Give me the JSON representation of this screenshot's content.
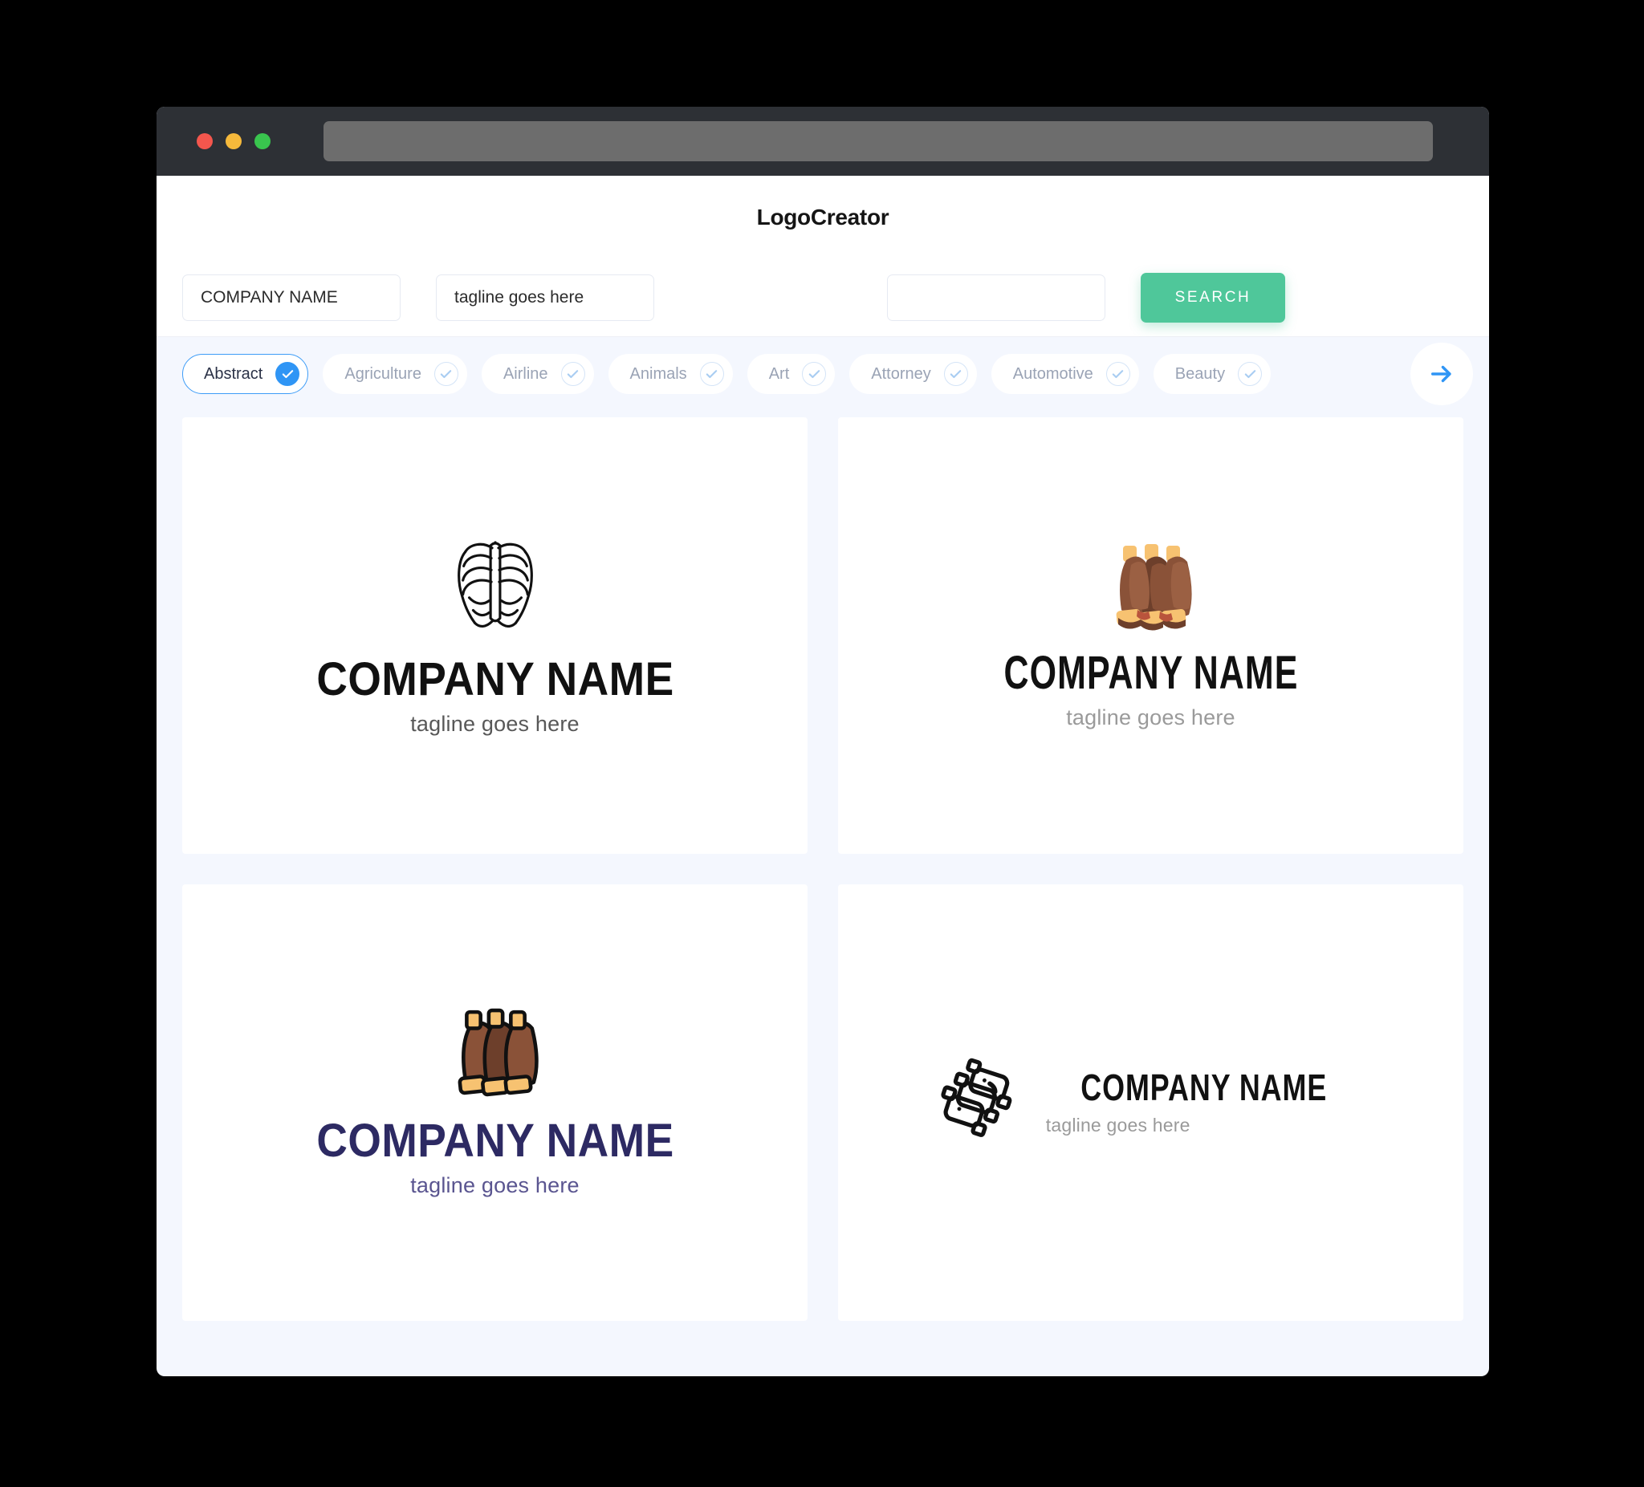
{
  "window": {
    "traffic_lights": [
      "close",
      "minimize",
      "maximize"
    ],
    "url_value": "",
    "colors": {
      "titlebar": "#2d3035",
      "urlbar": "#6d6d6d",
      "page_bg": "#f4f7fe",
      "accent_green": "#4fc79a",
      "accent_blue": "#2f95f5"
    }
  },
  "header": {
    "app_title": "LogoCreator"
  },
  "search": {
    "company_value": "COMPANY NAME",
    "company_placeholder": "COMPANY NAME",
    "tagline_value": "tagline goes here",
    "tagline_placeholder": "tagline goes here",
    "keyword_value": "",
    "keyword_placeholder": "",
    "search_button_label": "SEARCH"
  },
  "categories": {
    "next_icon": "arrow-right-icon",
    "items": [
      {
        "label": "Abstract",
        "selected": true,
        "check_icon": "check-icon"
      },
      {
        "label": "Agriculture",
        "selected": false,
        "check_icon": "check-icon"
      },
      {
        "label": "Airline",
        "selected": false,
        "check_icon": "check-icon"
      },
      {
        "label": "Animals",
        "selected": false,
        "check_icon": "check-icon"
      },
      {
        "label": "Art",
        "selected": false,
        "check_icon": "check-icon"
      },
      {
        "label": "Attorney",
        "selected": false,
        "check_icon": "check-icon"
      },
      {
        "label": "Automotive",
        "selected": false,
        "check_icon": "check-icon"
      },
      {
        "label": "Beauty",
        "selected": false,
        "check_icon": "check-icon"
      }
    ]
  },
  "results": [
    {
      "icon": "ribcage-outline-icon",
      "company_name": "COMPANY NAME",
      "tagline": "tagline goes here",
      "layout": "stacked",
      "name_color": "#111111",
      "tagline_color": "#585858"
    },
    {
      "icon": "bbq-ribs-flat-icon",
      "company_name": "COMPANY NAME",
      "tagline": "tagline goes here",
      "layout": "stacked",
      "name_color": "#111111",
      "tagline_color": "#9a9a9a"
    },
    {
      "icon": "bbq-ribs-outlined-icon",
      "company_name": "COMPANY NAME",
      "tagline": "tagline goes here",
      "layout": "stacked",
      "name_color": "#2d2a63",
      "tagline_color": "#5a5590"
    },
    {
      "icon": "ribs-line-icon",
      "company_name": "COMPANY NAME",
      "tagline": "tagline goes here",
      "layout": "horizontal",
      "name_color": "#111111",
      "tagline_color": "#9a9a9a"
    }
  ]
}
